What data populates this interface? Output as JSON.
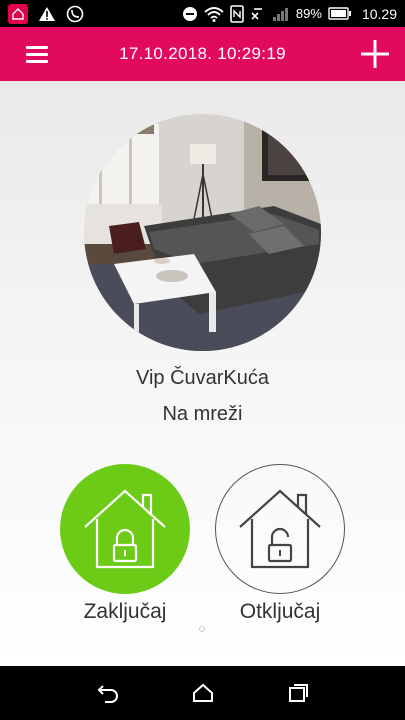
{
  "status_bar": {
    "battery_percent": "89%",
    "time": "10.29",
    "icons": [
      "app-notification-icon",
      "warning-icon",
      "viber-icon",
      "do-not-disturb-icon",
      "wifi-icon",
      "nfc-icon",
      "no-sim-icon",
      "signal-icon",
      "battery-icon"
    ]
  },
  "app_bar": {
    "datetime": "17.10.2018. 10:29:19",
    "menu_icon": "hamburger-menu-icon",
    "add_icon": "plus-icon",
    "color": "#e20a5e"
  },
  "device": {
    "name": "Vip ČuvarKuća",
    "status": "Na mreži"
  },
  "actions": {
    "lock_label": "Zaključaj",
    "unlock_label": "Otključaj",
    "lock_color": "#6ccb16"
  },
  "nav_bar": {
    "icons": [
      "back-icon",
      "home-icon",
      "recents-icon"
    ]
  }
}
